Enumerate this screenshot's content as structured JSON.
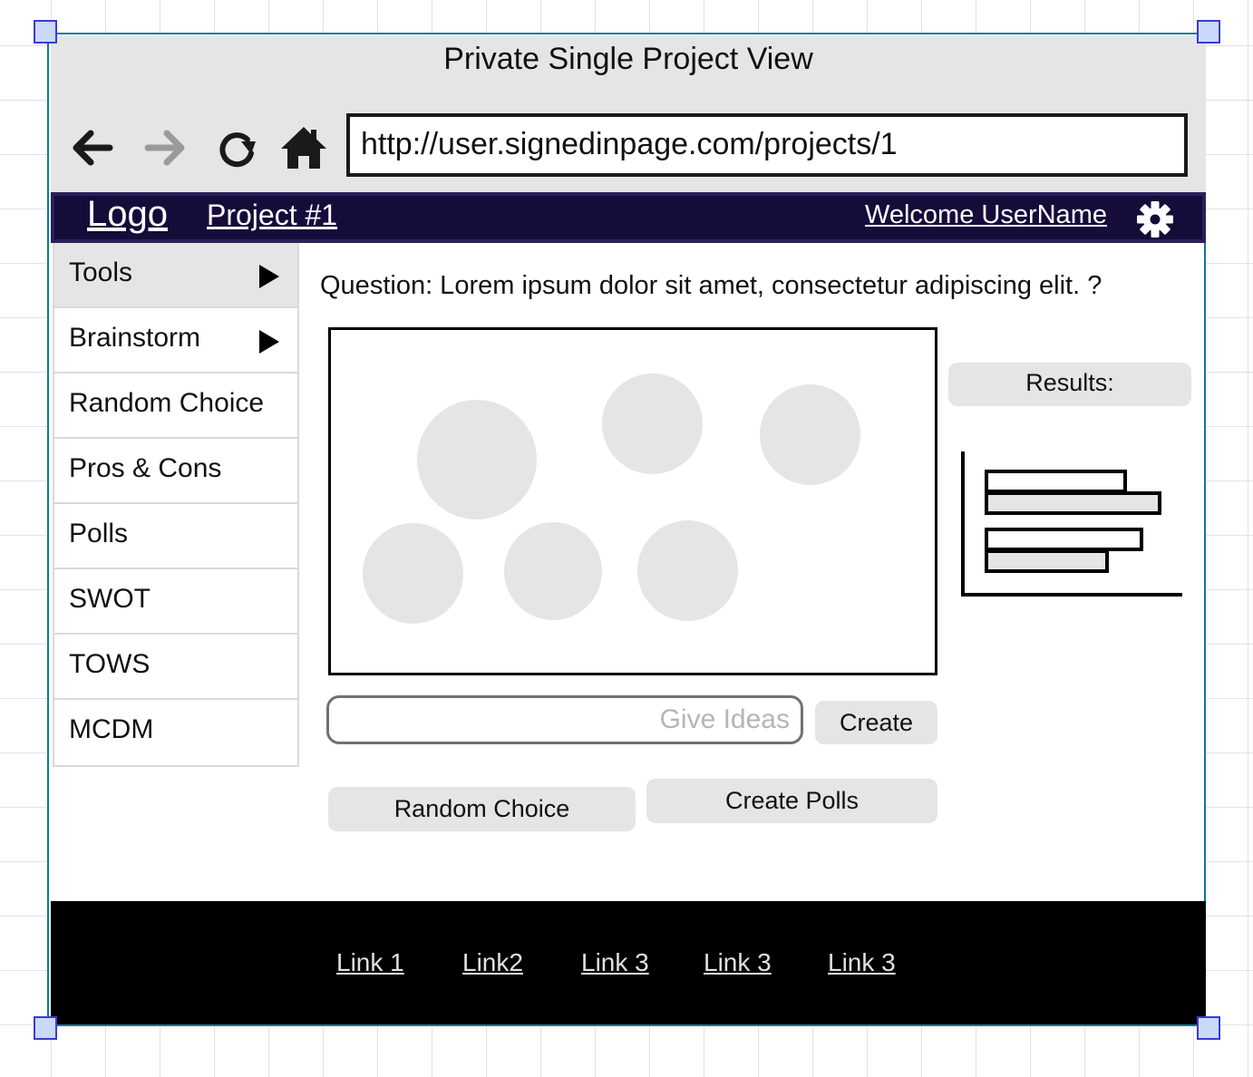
{
  "window": {
    "title": "Private Single Project View",
    "url": "http://user.signedinpage.com/projects/1"
  },
  "browser_icons": [
    "back-arrow-icon",
    "forward-arrow-icon",
    "reload-icon",
    "home-icon"
  ],
  "header": {
    "logo": "Logo",
    "project": "Project #1",
    "welcome": "Welcome UserName",
    "settings_icon": "gear-icon"
  },
  "sidebar": {
    "items": [
      {
        "label": "Tools",
        "has_submenu": true,
        "active": true
      },
      {
        "label": "Brainstorm",
        "has_submenu": true,
        "active": false
      },
      {
        "label": "Random Choice",
        "has_submenu": false,
        "active": false
      },
      {
        "label": "Pros & Cons",
        "has_submenu": false,
        "active": false
      },
      {
        "label": "Polls",
        "has_submenu": false,
        "active": false
      },
      {
        "label": "SWOT",
        "has_submenu": false,
        "active": false
      },
      {
        "label": "TOWS",
        "has_submenu": false,
        "active": false
      },
      {
        "label": "MCDM",
        "has_submenu": false,
        "active": false
      }
    ]
  },
  "main": {
    "question": "Question: Lorem ipsum dolor sit amet, consectetur adipiscing elit. ?",
    "ideas_placeholder": "Give Ideas",
    "create_label": "Create",
    "random_choice_label": "Random Choice",
    "create_polls_label": "Create Polls",
    "results_label": "Results:"
  },
  "footer": {
    "links": [
      "Link 1",
      "Link2",
      "Link 3",
      "Link 3",
      "Link 3"
    ]
  },
  "colors": {
    "nav_bar": "#160c3a",
    "footer": "#000000",
    "panel_gray": "#e5e5e5",
    "selection_handle": "#3a3ad6"
  }
}
